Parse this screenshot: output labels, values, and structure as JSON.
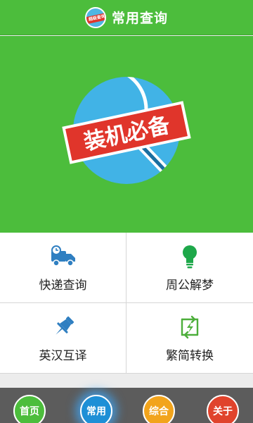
{
  "header": {
    "title": "常用查询",
    "logo_text": "超级查询"
  },
  "banner": {
    "badge_text": "装机必备"
  },
  "tiles": [
    {
      "label": "快递查询",
      "icon": "delivery-truck-icon",
      "color": "#2f7fc1"
    },
    {
      "label": "周公解梦",
      "icon": "lightbulb-icon",
      "color": "#1ea84a"
    },
    {
      "label": "英汉互译",
      "icon": "pushpin-icon",
      "color": "#2f7fc1"
    },
    {
      "label": "繁简转换",
      "icon": "convert-arrows-icon",
      "color": "#4cae3a"
    }
  ],
  "nav": [
    {
      "label": "首页",
      "color": "#4cbd3c"
    },
    {
      "label": "常用",
      "color": "#1e8fd6",
      "active": true
    },
    {
      "label": "综合",
      "color": "#f2a41c"
    },
    {
      "label": "关于",
      "color": "#e0432c"
    }
  ],
  "colors": {
    "primary_green": "#4cbd3c",
    "nav_background": "#5c5c5c"
  }
}
